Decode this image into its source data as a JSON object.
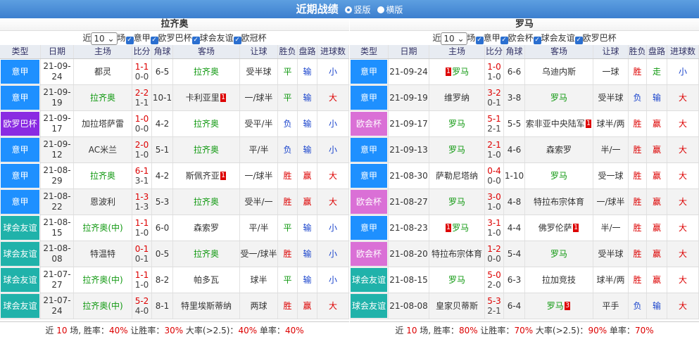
{
  "title": "近期战绩",
  "radio1": "竖版",
  "radio2": "横版",
  "left": {
    "team": "拉齐奥",
    "near": "近",
    "count": "10",
    "chang": "场",
    "filters": [
      "意甲",
      "欧罗巴杯",
      "球会友谊",
      "欧冠杯"
    ],
    "headers": [
      "类型",
      "日期",
      "主场",
      "比分",
      "角球",
      "客场",
      "让球",
      "胜负",
      "盘路",
      "进球数"
    ],
    "rows": [
      {
        "type": "意甲",
        "tc": "c-yj",
        "date": "21-09-24",
        "home": "都灵",
        "hg": false,
        "ft": "1-1",
        "ht": "0-0",
        "corner": "6-5",
        "away": "拉齐奥",
        "ag": true,
        "hrc": "",
        "arc": "",
        "hc": "受半球",
        "wl": "平",
        "wlc": "green",
        "pan": "输",
        "panc": "blue",
        "goal": "小",
        "goalc": "blue"
      },
      {
        "type": "意甲",
        "tc": "c-yj",
        "date": "21-09-19",
        "home": "拉齐奥",
        "hg": true,
        "ft": "2-2",
        "ht": "1-1",
        "corner": "10-1",
        "away": "卡利亚里",
        "ag": false,
        "hrc": "",
        "arc": "1",
        "hc": "一/球半",
        "wl": "平",
        "wlc": "green",
        "pan": "输",
        "panc": "blue",
        "goal": "大",
        "goalc": "red"
      },
      {
        "type": "欧罗巴杯",
        "tc": "c-oy",
        "date": "21-09-17",
        "home": "加拉塔萨雷",
        "hg": false,
        "ft": "1-0",
        "ht": "0-0",
        "corner": "4-2",
        "away": "拉齐奥",
        "ag": true,
        "hrc": "",
        "arc": "",
        "hc": "受平/半",
        "wl": "负",
        "wlc": "blue",
        "pan": "输",
        "panc": "blue",
        "goal": "小",
        "goalc": "blue"
      },
      {
        "type": "意甲",
        "tc": "c-yj",
        "date": "21-09-12",
        "home": "AC米兰",
        "hg": false,
        "ft": "2-0",
        "ht": "1-0",
        "corner": "5-1",
        "away": "拉齐奥",
        "ag": true,
        "hrc": "",
        "arc": "",
        "hc": "平/半",
        "wl": "负",
        "wlc": "blue",
        "pan": "输",
        "panc": "blue",
        "goal": "小",
        "goalc": "blue"
      },
      {
        "type": "意甲",
        "tc": "c-yj",
        "date": "21-08-29",
        "home": "拉齐奥",
        "hg": true,
        "ft": "6-1",
        "ht": "3-1",
        "corner": "4-2",
        "away": "斯佩齐亚",
        "ag": false,
        "hrc": "",
        "arc": "1",
        "hc": "一/球半",
        "wl": "胜",
        "wlc": "red",
        "pan": "赢",
        "panc": "red",
        "goal": "大",
        "goalc": "red"
      },
      {
        "type": "意甲",
        "tc": "c-yj",
        "date": "21-08-22",
        "home": "恩波利",
        "hg": false,
        "ft": "1-3",
        "ht": "1-3",
        "corner": "5-3",
        "away": "拉齐奥",
        "ag": true,
        "hrc": "",
        "arc": "",
        "hc": "受半/一",
        "wl": "胜",
        "wlc": "red",
        "pan": "赢",
        "panc": "red",
        "goal": "大",
        "goalc": "red"
      },
      {
        "type": "球会友谊",
        "tc": "c-qh",
        "date": "21-08-15",
        "home": "拉齐奥(中)",
        "hg": true,
        "ft": "1-1",
        "ht": "1-0",
        "corner": "6-0",
        "away": "森索罗",
        "ag": false,
        "hrc": "",
        "arc": "",
        "hc": "平/半",
        "wl": "平",
        "wlc": "green",
        "pan": "输",
        "panc": "blue",
        "goal": "小",
        "goalc": "blue"
      },
      {
        "type": "球会友谊",
        "tc": "c-qh",
        "date": "21-08-08",
        "home": "特温特",
        "hg": false,
        "ft": "0-1",
        "ht": "0-1",
        "corner": "0-5",
        "away": "拉齐奥",
        "ag": true,
        "hrc": "",
        "arc": "",
        "hc": "受一/球半",
        "wl": "胜",
        "wlc": "red",
        "pan": "输",
        "panc": "blue",
        "goal": "小",
        "goalc": "blue"
      },
      {
        "type": "球会友谊",
        "tc": "c-qh",
        "date": "21-07-27",
        "home": "拉齐奥(中)",
        "hg": true,
        "ft": "1-1",
        "ht": "1-0",
        "corner": "8-2",
        "away": "帕多瓦",
        "ag": false,
        "hrc": "",
        "arc": "",
        "hc": "球半",
        "wl": "平",
        "wlc": "green",
        "pan": "输",
        "panc": "blue",
        "goal": "小",
        "goalc": "blue"
      },
      {
        "type": "球会友谊",
        "tc": "c-qh",
        "date": "21-07-24",
        "home": "拉齐奥(中)",
        "hg": true,
        "ft": "5-2",
        "ht": "4-0",
        "corner": "8-1",
        "away": "特里埃斯蒂纳",
        "ag": false,
        "hrc": "",
        "arc": "",
        "hc": "两球",
        "wl": "胜",
        "wlc": "red",
        "pan": "赢",
        "panc": "red",
        "goal": "大",
        "goalc": "red"
      }
    ],
    "foot": {
      "a": "近 ",
      "n": "10",
      "b": " 场, 胜率：",
      "w": "40%",
      "c": " 让胜率：",
      "hw": "30%",
      "d": " 大率(>2.5)：",
      "big": "40%",
      "e": " 单率：",
      "odd": "40%"
    }
  },
  "right": {
    "team": "罗马",
    "near": "近",
    "count": "10",
    "chang": "场",
    "filters": [
      "意甲",
      "欧会杯",
      "球会友谊",
      "欧罗巴杯"
    ],
    "headers": [
      "类型",
      "日期",
      "主场",
      "比分",
      "角球",
      "客场",
      "让球",
      "胜负",
      "盘路",
      "进球数"
    ],
    "rows": [
      {
        "type": "意甲",
        "tc": "c-yj",
        "date": "21-09-24",
        "home": "罗马",
        "hg": true,
        "ft": "1-0",
        "ht": "1-0",
        "corner": "6-6",
        "away": "乌迪内斯",
        "ag": false,
        "hrc": "1",
        "arc": "",
        "hc": "一球",
        "wl": "胜",
        "wlc": "red",
        "pan": "走",
        "panc": "green",
        "goal": "小",
        "goalc": "blue"
      },
      {
        "type": "意甲",
        "tc": "c-yj",
        "date": "21-09-19",
        "home": "维罗纳",
        "hg": false,
        "ft": "3-2",
        "ht": "0-1",
        "corner": "3-8",
        "away": "罗马",
        "ag": true,
        "hrc": "",
        "arc": "",
        "hc": "受半球",
        "wl": "负",
        "wlc": "blue",
        "pan": "输",
        "panc": "blue",
        "goal": "大",
        "goalc": "red"
      },
      {
        "type": "欧会杯",
        "tc": "c-og",
        "date": "21-09-17",
        "home": "罗马",
        "hg": true,
        "ft": "5-1",
        "ht": "2-1",
        "corner": "5-5",
        "away": "索非亚中央陆军",
        "ag": false,
        "hrc": "",
        "arc": "1",
        "hc": "球半/两",
        "wl": "胜",
        "wlc": "red",
        "pan": "赢",
        "panc": "red",
        "goal": "大",
        "goalc": "red"
      },
      {
        "type": "意甲",
        "tc": "c-yj",
        "date": "21-09-13",
        "home": "罗马",
        "hg": true,
        "ft": "2-1",
        "ht": "1-0",
        "corner": "4-6",
        "away": "森索罗",
        "ag": false,
        "hrc": "",
        "arc": "",
        "hc": "半/一",
        "wl": "胜",
        "wlc": "red",
        "pan": "赢",
        "panc": "red",
        "goal": "大",
        "goalc": "red"
      },
      {
        "type": "意甲",
        "tc": "c-yj",
        "date": "21-08-30",
        "home": "萨勒尼塔纳",
        "hg": false,
        "ft": "0-4",
        "ht": "0-0",
        "corner": "1-10",
        "away": "罗马",
        "ag": true,
        "hrc": "",
        "arc": "",
        "hc": "受一球",
        "wl": "胜",
        "wlc": "red",
        "pan": "赢",
        "panc": "red",
        "goal": "大",
        "goalc": "red"
      },
      {
        "type": "欧会杯",
        "tc": "c-og",
        "date": "21-08-27",
        "home": "罗马",
        "hg": true,
        "ft": "3-0",
        "ht": "1-0",
        "corner": "4-8",
        "away": "特拉布宗体育",
        "ag": false,
        "hrc": "",
        "arc": "",
        "hc": "一/球半",
        "wl": "胜",
        "wlc": "red",
        "pan": "赢",
        "panc": "red",
        "goal": "大",
        "goalc": "red"
      },
      {
        "type": "意甲",
        "tc": "c-yj",
        "date": "21-08-23",
        "home": "罗马",
        "hg": true,
        "ft": "3-1",
        "ht": "1-0",
        "corner": "4-4",
        "away": "佛罗伦萨",
        "ag": false,
        "hrc": "1",
        "arc": "1",
        "hc": "半/一",
        "wl": "胜",
        "wlc": "red",
        "pan": "赢",
        "panc": "red",
        "goal": "大",
        "goalc": "red"
      },
      {
        "type": "欧会杯",
        "tc": "c-og",
        "date": "21-08-20",
        "home": "特拉布宗体育",
        "hg": false,
        "ft": "1-2",
        "ht": "0-0",
        "corner": "5-4",
        "away": "罗马",
        "ag": true,
        "hrc": "",
        "arc": "",
        "hc": "受半球",
        "wl": "胜",
        "wlc": "red",
        "pan": "赢",
        "panc": "red",
        "goal": "大",
        "goalc": "red"
      },
      {
        "type": "球会友谊",
        "tc": "c-qh",
        "date": "21-08-15",
        "home": "罗马",
        "hg": true,
        "ft": "5-0",
        "ht": "2-0",
        "corner": "6-3",
        "away": "拉加竞技",
        "ag": false,
        "hrc": "",
        "arc": "",
        "hc": "球半/两",
        "wl": "胜",
        "wlc": "red",
        "pan": "赢",
        "panc": "red",
        "goal": "大",
        "goalc": "red"
      },
      {
        "type": "球会友谊",
        "tc": "c-qh",
        "date": "21-08-08",
        "home": "皇家贝蒂斯",
        "hg": false,
        "ft": "5-3",
        "ht": "2-1",
        "corner": "6-4",
        "away": "罗马",
        "ag": true,
        "hrc": "",
        "arc": "3",
        "hc": "平手",
        "wl": "负",
        "wlc": "blue",
        "pan": "输",
        "panc": "blue",
        "goal": "大",
        "goalc": "red"
      }
    ],
    "foot": {
      "a": "近 ",
      "n": "10",
      "b": " 场, 胜率：",
      "w": "80%",
      "c": " 让胜率：",
      "hw": "70%",
      "d": " 大率(>2.5)：",
      "big": "90%",
      "e": " 单率：",
      "odd": "70%"
    }
  }
}
